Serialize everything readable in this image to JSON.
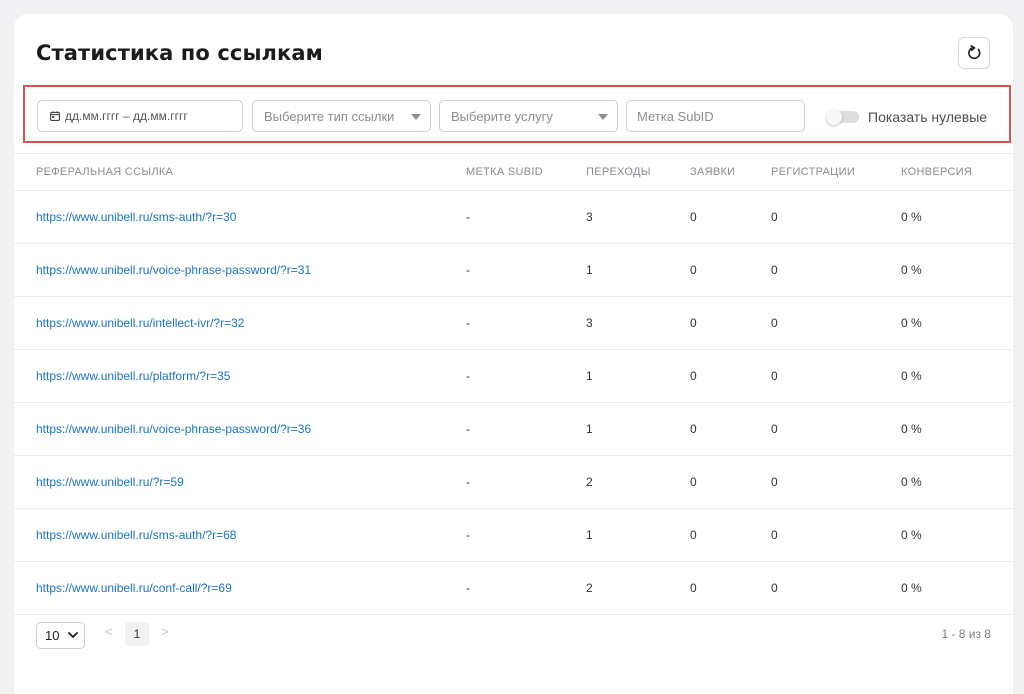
{
  "header": {
    "title": "Статистика по ссылкам",
    "refresh_icon": "refresh-icon"
  },
  "filters": {
    "date_range": {
      "placeholder": "дд.мм.гггг – дд.мм.гггг",
      "icon": "calendar-icon"
    },
    "link_type": {
      "placeholder": "Выберите тип ссылки"
    },
    "service": {
      "placeholder": "Выберите услугу"
    },
    "subid": {
      "placeholder": "Метка SubID"
    },
    "show_zero": {
      "label": "Показать нулевые",
      "enabled": false
    }
  },
  "table": {
    "columns": [
      "РЕФЕРАЛЬНАЯ ССЫЛКА",
      "МЕТКА SUBID",
      "ПЕРЕХОДЫ",
      "ЗАЯВКИ",
      "РЕГИСТРАЦИИ",
      "КОНВЕРСИЯ"
    ],
    "rows": [
      {
        "link": "https://www.unibell.ru/sms-auth/?r=30",
        "subid": "-",
        "clicks": "3",
        "requests": "0",
        "registrations": "0",
        "conversion": "0 %"
      },
      {
        "link": "https://www.unibell.ru/voice-phrase-password/?r=31",
        "subid": "-",
        "clicks": "1",
        "requests": "0",
        "registrations": "0",
        "conversion": "0 %"
      },
      {
        "link": "https://www.unibell.ru/intellect-ivr/?r=32",
        "subid": "-",
        "clicks": "3",
        "requests": "0",
        "registrations": "0",
        "conversion": "0 %"
      },
      {
        "link": "https://www.unibell.ru/platform/?r=35",
        "subid": "-",
        "clicks": "1",
        "requests": "0",
        "registrations": "0",
        "conversion": "0 %"
      },
      {
        "link": "https://www.unibell.ru/voice-phrase-password/?r=36",
        "subid": "-",
        "clicks": "1",
        "requests": "0",
        "registrations": "0",
        "conversion": "0 %"
      },
      {
        "link": "https://www.unibell.ru/?r=59",
        "subid": "-",
        "clicks": "2",
        "requests": "0",
        "registrations": "0",
        "conversion": "0 %"
      },
      {
        "link": "https://www.unibell.ru/sms-auth/?r=68",
        "subid": "-",
        "clicks": "1",
        "requests": "0",
        "registrations": "0",
        "conversion": "0 %"
      },
      {
        "link": "https://www.unibell.ru/conf-call/?r=69",
        "subid": "-",
        "clicks": "2",
        "requests": "0",
        "registrations": "0",
        "conversion": "0 %"
      }
    ]
  },
  "pagination": {
    "per_page": "10",
    "prev": "<",
    "current_page": "1",
    "next": ">",
    "range_text": "1 - 8 из 8"
  },
  "colors": {
    "link": "#1a73c9",
    "highlight_border": "#d9534f",
    "background": "#f1f1f3"
  }
}
